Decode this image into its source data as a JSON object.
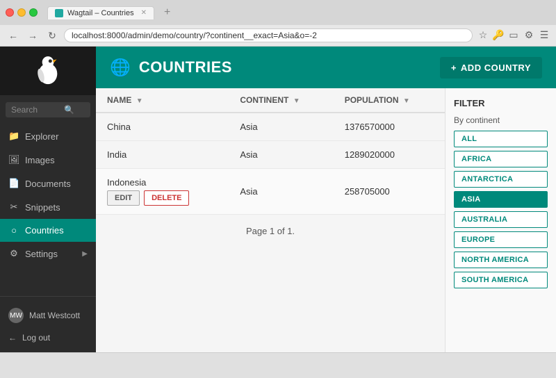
{
  "browser": {
    "tab_title": "Wagtail – Countries",
    "tab_icon": "wagtail-icon",
    "address": "localhost:8000/admin/demo/country/?continent__exact=Asia&o=-2",
    "nav": {
      "back": "←",
      "forward": "→",
      "reload": "↻"
    }
  },
  "sidebar": {
    "search_placeholder": "Search",
    "nav_items": [
      {
        "id": "explorer",
        "label": "Explorer",
        "icon": "📁"
      },
      {
        "id": "images",
        "label": "Images",
        "icon": "🖼"
      },
      {
        "id": "documents",
        "label": "Documents",
        "icon": "📄"
      },
      {
        "id": "snippets",
        "label": "Snippets",
        "icon": "✂"
      },
      {
        "id": "countries",
        "label": "Countries",
        "icon": "○",
        "active": true
      },
      {
        "id": "settings",
        "label": "Settings",
        "icon": "⚙",
        "has_arrow": true
      }
    ],
    "user_name": "Matt Westcott",
    "logout_label": "Log out"
  },
  "page": {
    "title": "COUNTRIES",
    "globe_icon": "🌐",
    "add_button_label": "ADD COUNTRY"
  },
  "table": {
    "columns": [
      {
        "id": "name",
        "label": "NAME",
        "sortable": true
      },
      {
        "id": "continent",
        "label": "CONTINENT",
        "sortable": true
      },
      {
        "id": "population",
        "label": "POPULATION",
        "sortable": true
      }
    ],
    "rows": [
      {
        "id": 1,
        "name": "China",
        "continent": "Asia",
        "population": "1376570000",
        "expanded": false
      },
      {
        "id": 2,
        "name": "India",
        "continent": "Asia",
        "population": "1289020000",
        "expanded": false
      },
      {
        "id": 3,
        "name": "Indonesia",
        "continent": "Asia",
        "population": "258705000",
        "expanded": true
      }
    ],
    "row_actions": {
      "edit": "EDIT",
      "delete": "DELETE"
    },
    "pagination": "Page 1 of 1."
  },
  "filter": {
    "title": "FILTER",
    "subtitle": "By continent",
    "options": [
      {
        "id": "all",
        "label": "ALL",
        "active": false
      },
      {
        "id": "africa",
        "label": "AFRICA",
        "active": false
      },
      {
        "id": "antarctica",
        "label": "ANTARCTICA",
        "active": false
      },
      {
        "id": "asia",
        "label": "ASIA",
        "active": true
      },
      {
        "id": "australia",
        "label": "AUSTRALIA",
        "active": false
      },
      {
        "id": "europe",
        "label": "EUROPE",
        "active": false
      },
      {
        "id": "north-america",
        "label": "NORTH AMERICA",
        "active": false
      },
      {
        "id": "south-america",
        "label": "SOUTH AMERICA",
        "active": false
      }
    ]
  }
}
